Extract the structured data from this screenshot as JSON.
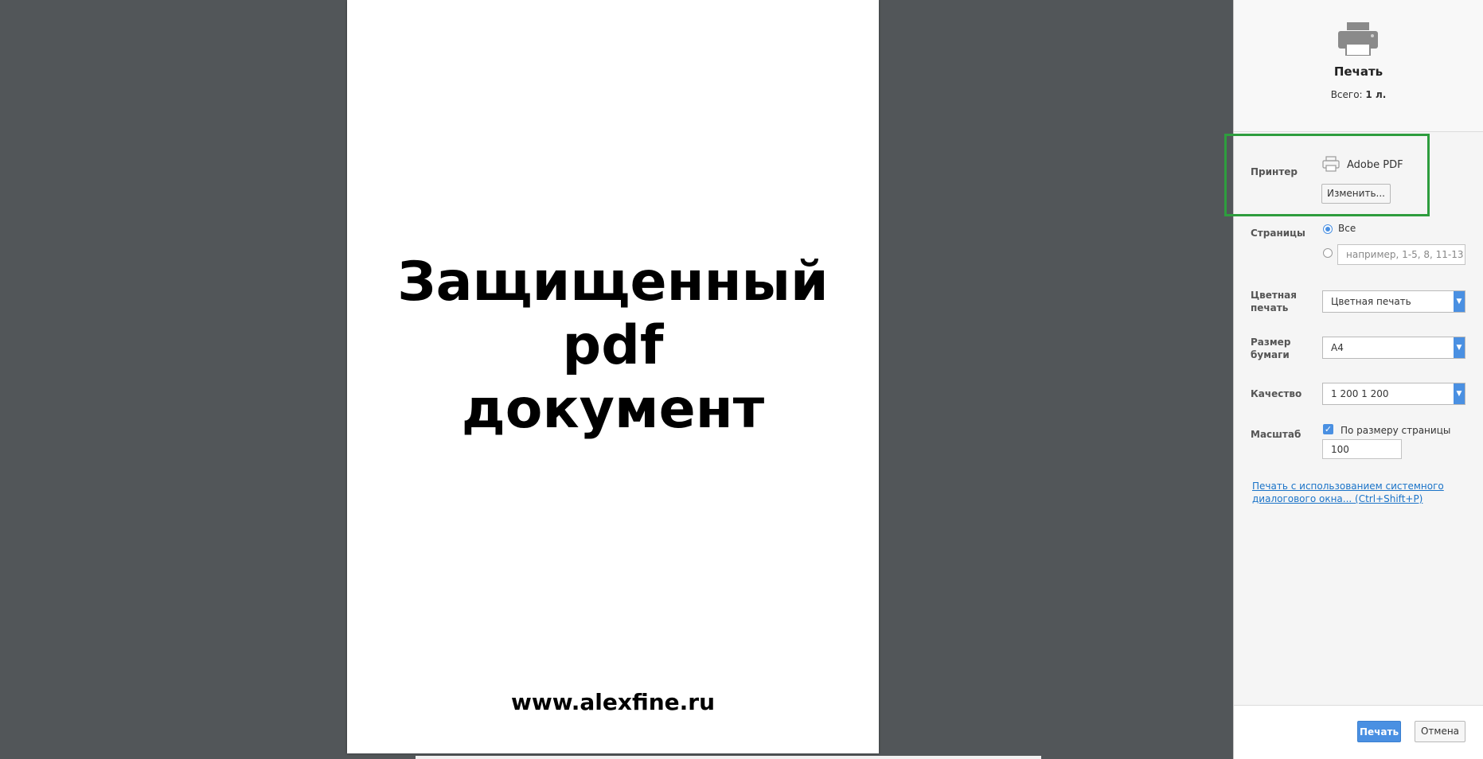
{
  "document": {
    "title_lines": [
      "Защищенный",
      "pdf",
      "документ"
    ],
    "footer": "www.alexfine.ru"
  },
  "sidebar": {
    "title": "Печать",
    "total_label": "Всего:",
    "total_value": "1 л.",
    "printer": {
      "label": "Принтер",
      "name": "Adobe PDF",
      "change_button": "Изменить..."
    },
    "pages": {
      "label": "Страницы",
      "option_all": "Все",
      "range_placeholder": "например, 1-5, 8, 11-13"
    },
    "color": {
      "label_line1": "Цветная",
      "label_line2": "печать",
      "value": "Цветная печать"
    },
    "paper": {
      "label_line1": "Размер",
      "label_line2": "бумаги",
      "value": "A4"
    },
    "quality": {
      "label": "Качество",
      "value": "1 200 1 200"
    },
    "scale": {
      "label": "Масштаб",
      "fit_label": "По размеру страницы",
      "value": "100"
    },
    "system_dialog_link_line1": "Печать с использованием системного",
    "system_dialog_link_line2": "диалогового окна... (Ctrl+Shift+P)",
    "print_button": "Печать",
    "cancel_button": "Отмена"
  },
  "colors": {
    "accent": "#4a90e2",
    "highlight": "#2e9d3e",
    "background": "#525659"
  },
  "icons": {
    "header_icon": "printer-icon",
    "printer_row_icon": "printer-icon"
  }
}
